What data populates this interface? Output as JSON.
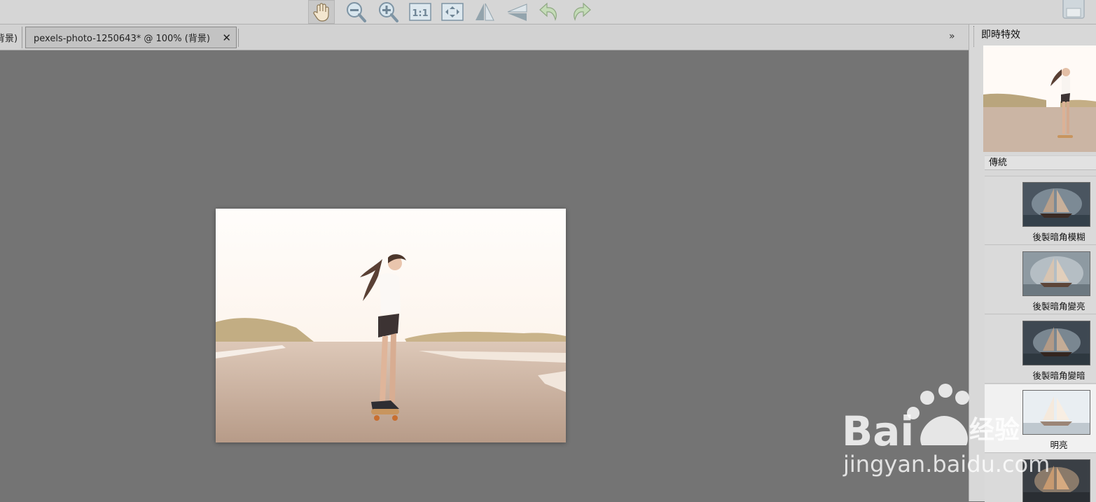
{
  "toolbar": {
    "tools": [
      "hand-tool",
      "zoom-out",
      "zoom-in",
      "actual-size",
      "fit-window",
      "flip-horizontal",
      "flip-vertical",
      "rotate-left",
      "rotate-right"
    ],
    "active_tool": "hand-tool",
    "actual_size_label": "1:1"
  },
  "tabs": {
    "previous_tab_fragment": "背景)",
    "active_tab_label": "pexels-photo-1250643* @ 100% (背景)",
    "close_symbol": "✕",
    "scroll_symbol": "»"
  },
  "panel": {
    "title": "即時特效",
    "category": "傳統",
    "effects": [
      {
        "label": "後製暗角模糊",
        "selected": false
      },
      {
        "label": "後製暗角變亮",
        "selected": false
      },
      {
        "label": "後製暗角變暗",
        "selected": false
      },
      {
        "label": "明亮",
        "selected": true
      },
      {
        "label": "",
        "selected": false
      }
    ]
  },
  "watermark": {
    "url_text": "jingyan.baidu.com"
  },
  "colors": {
    "canvas_bg": "#747474",
    "toolbar_bg": "#d6d6d6",
    "panel_bg": "#d8d8d8",
    "selected_effect_bg": "#f1f1f1"
  }
}
